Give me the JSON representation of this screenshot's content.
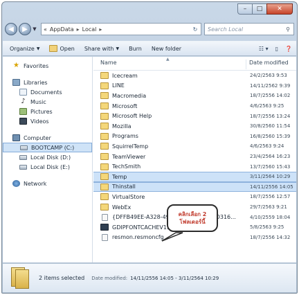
{
  "address": {
    "crumbs": [
      "«",
      "AppData",
      "▸",
      "Local",
      "▸"
    ],
    "search_placeholder": "Search Local"
  },
  "toolbar": {
    "organize": "Organize",
    "open": "Open",
    "share_with": "Share with",
    "burn": "Burn",
    "new_folder": "New folder"
  },
  "nav": {
    "favorites": "Favorites",
    "libraries": "Libraries",
    "documents": "Documents",
    "music": "Music",
    "pictures": "Pictures",
    "videos": "Videos",
    "computer": "Computer",
    "bootcamp": "BOOTCAMP (C:)",
    "local_d": "Local Disk (D:)",
    "local_e": "Local Disk (E:)",
    "network": "Network"
  },
  "columns": {
    "name": "Name",
    "date_modified": "Date modified"
  },
  "files": [
    {
      "name": "Icecream",
      "date": "24/2/2563 9:53",
      "kind": "folder"
    },
    {
      "name": "LINE",
      "date": "14/11/2562 9:39",
      "kind": "folder"
    },
    {
      "name": "Macromedia",
      "date": "18/7/2556 14:02",
      "kind": "folder"
    },
    {
      "name": "Microsoft",
      "date": "4/6/2563 9:25",
      "kind": "folder"
    },
    {
      "name": "Microsoft Help",
      "date": "18/7/2556 13:24",
      "kind": "folder"
    },
    {
      "name": "Mozilla",
      "date": "30/8/2560 11:54",
      "kind": "folder"
    },
    {
      "name": "Programs",
      "date": "16/8/2560 15:39",
      "kind": "folder"
    },
    {
      "name": "SquirrelTemp",
      "date": "4/6/2563 9:24",
      "kind": "folder"
    },
    {
      "name": "TeamViewer",
      "date": "23/4/2564 16:23",
      "kind": "folder"
    },
    {
      "name": "TechSmith",
      "date": "13/7/2560 15:43",
      "kind": "folder"
    },
    {
      "name": "Temp",
      "date": "3/11/2564 10:29",
      "kind": "folder",
      "selected": true
    },
    {
      "name": "Thinstall",
      "date": "14/11/2556 14:05",
      "kind": "folder",
      "selected": true
    },
    {
      "name": "VirtualStore",
      "date": "18/7/2556 12:57",
      "kind": "folder"
    },
    {
      "name": "WebEx",
      "date": "29/7/2563 9:21",
      "kind": "folder"
    },
    {
      "name": "{DFFB49EE-A328-4981-8030-B61605D316...",
      "date": "4/10/2559 18:04",
      "kind": "file"
    },
    {
      "name": "GDIPFONTCACHEV1.DAT",
      "date": "5/8/2563 9:25",
      "kind": "dat"
    },
    {
      "name": "resmon.resmoncfg",
      "date": "18/7/2556 14:32",
      "kind": "file"
    }
  ],
  "callout": {
    "line1": "คลิกเลือก 2",
    "line2": "โฟลเดอร์นี้"
  },
  "details": {
    "summary": "2 items selected",
    "date_label": "Date modified:",
    "date_value": "14/11/2556 14:05 - 3/11/2564 10:29"
  }
}
